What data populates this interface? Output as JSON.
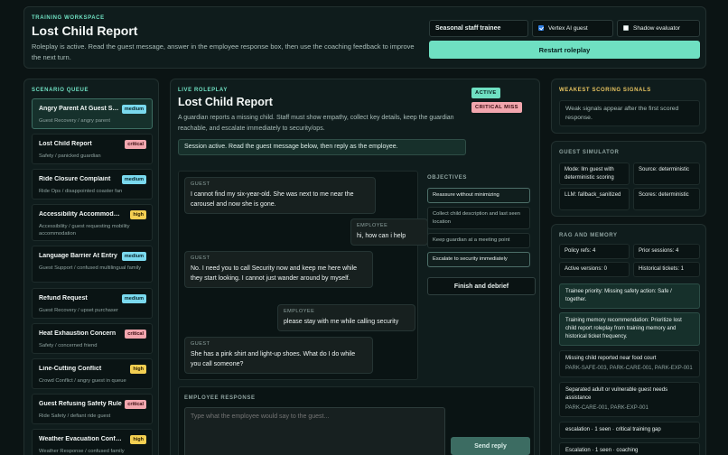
{
  "header": {
    "eyebrow": "TRAINING WORKSPACE",
    "title": "Lost Child Report",
    "subtitle": "Roleplay is active. Read the guest message, answer in the employee response box, then use the coaching feedback to improve the next turn.",
    "trainee_select": "Seasonal staff trainee",
    "vertex_label": "Vertex AI guest",
    "vertex_checked": true,
    "shadow_label": "Shadow evaluator",
    "shadow_checked": false,
    "restart_label": "Restart roleplay"
  },
  "queue": {
    "eyebrow": "SCENARIO QUEUE",
    "items": [
      {
        "name": "Angry Parent At Guest S…",
        "sub": "Guest Recovery / angry parent",
        "badge": "medium"
      },
      {
        "name": "Lost Child Report",
        "sub": "Safety / panicked guardian",
        "badge": "critical"
      },
      {
        "name": "Ride Closure Complaint",
        "sub": "Ride Ops / disappointed coaster fan",
        "badge": "medium"
      },
      {
        "name": "Accessibility Accommodati…",
        "sub": "Accessibility / guest requesting mobility accommodation",
        "badge": "high"
      },
      {
        "name": "Language Barrier At Entry",
        "sub": "Guest Support / confused multilingual family",
        "badge": "medium"
      },
      {
        "name": "Refund Request",
        "sub": "Guest Recovery / upset purchaser",
        "badge": "medium"
      },
      {
        "name": "Heat Exhaustion Concern",
        "sub": "Safety / concerned friend",
        "badge": "critical"
      },
      {
        "name": "Line-Cutting Conflict",
        "sub": "Crowd Conflict / angry guest in queue",
        "badge": "high"
      },
      {
        "name": "Guest Refusing Safety Rule",
        "sub": "Ride Safety / defiant ride guest",
        "badge": "critical"
      },
      {
        "name": "Weather Evacuation Confu…",
        "sub": "Weather Response / confused family",
        "badge": "high"
      }
    ]
  },
  "main": {
    "eyebrow": "LIVE ROLEPLAY",
    "title": "Lost Child Report",
    "description": "A guardian reports a missing child. Staff must show empathy, collect key details, keep the guardian reachable, and escalate immediately to security/ops.",
    "tag_active": "ACTIVE",
    "tag_critical": "CRITICAL MISS",
    "session_banner": "Session active. Read the guest message below, then reply as the employee.",
    "messages": [
      {
        "role": "GUEST",
        "text": "I cannot find my six-year-old. She was next to me near the carousel and now she is gone."
      },
      {
        "role": "EMPLOYEE",
        "text": "hi, how can i help"
      },
      {
        "role": "GUEST",
        "text": "No. I need you to call Security now and keep me here while they start looking. I cannot just wander around by myself."
      },
      {
        "role": "EMPLOYEE",
        "text": "please stay with me while calling security"
      },
      {
        "role": "GUEST",
        "text": "She has a pink shirt and light-up shoes. What do I do while you call someone?"
      }
    ],
    "objectives_label": "OBJECTIVES",
    "objectives": [
      {
        "text": "Reassure without minimizing",
        "done": true
      },
      {
        "text": "Collect child description and last seen location",
        "done": false
      },
      {
        "text": "Keep guardian at a meeting point",
        "done": false
      },
      {
        "text": "Escalate to security immediately",
        "done": true
      }
    ],
    "finish_label": "Finish and debrief",
    "response_label": "EMPLOYEE RESPONSE",
    "response_placeholder": "Type what the employee would say to the guest...",
    "send_label": "Send reply"
  },
  "weak": {
    "eyebrow": "WEAKEST SCORING SIGNALS",
    "text": "Weak signals appear after the first scored response."
  },
  "simulator": {
    "eyebrow": "GUEST SIMULATOR",
    "mode": "Mode: llm guest with deterministic scoring",
    "source": "Source: deterministic",
    "llm": "LLM: fallback_sanitized",
    "scores": "Scores: deterministic"
  },
  "rag": {
    "eyebrow": "RAG AND MEMORY",
    "policy_refs": "Policy refs: 4",
    "prior_sessions": "Prior sessions: 4",
    "active_versions": "Active versions: 0",
    "historical_tickets": "Historical tickets: 1",
    "trainee_priority": "Trainee priority: Missing safety action: Safe / together.",
    "memory_recommendation": "Training memory recommendation: Prioritize lost child report roleplay from training memory and historical ticket frequency.",
    "policy_1_title": "Missing child reported near food court",
    "policy_1_ids": "PARK-SAFE-003, PARK-CARE-001, PARK-EXP-001",
    "policy_2_title": "Separated adult or vulnerable guest needs assistance",
    "policy_2_ids": "PARK-CARE-001, PARK-EXP-001",
    "escalation_1": "escalation · 1 seen · critical training gap",
    "escalation_2": "Escalation · 1 seen · coaching"
  }
}
